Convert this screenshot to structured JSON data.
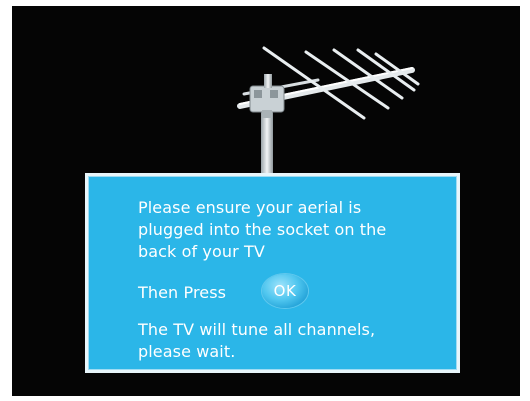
{
  "dialog": {
    "message": "Please ensure your aerial is plugged into the socket on the back of your TV",
    "then_press_label": "Then Press",
    "ok_button_label": "OK",
    "wait_message": "The TV will tune all channels, please wait."
  },
  "icons": {
    "illustration": "tv-aerial-antenna-icon"
  },
  "colors": {
    "panel_background": "#2bb6e8",
    "panel_border": "#e8f6fb",
    "screen_background": "#050505",
    "text": "#ffffff"
  }
}
